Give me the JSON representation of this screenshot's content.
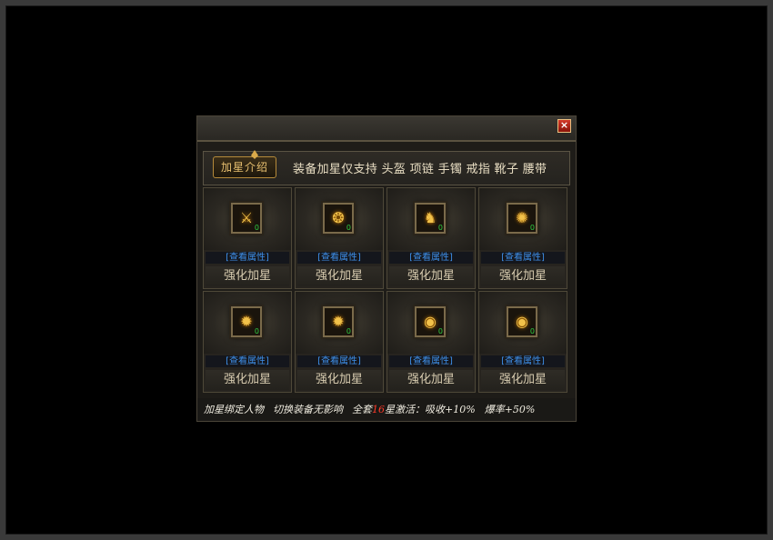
{
  "dialog": {
    "close_label": "×",
    "badge": "加星介绍",
    "support_text": "装备加星仅支持 头盔 项链 手镯 戒指 靴子 腰带"
  },
  "items": [
    {
      "icon": "sword-icon",
      "glyph": "⚔",
      "stars": "0",
      "view_label": "[查看属性]",
      "enhance_label": "强化加星"
    },
    {
      "icon": "necklace-icon",
      "glyph": "❂",
      "stars": "0",
      "view_label": "[查看属性]",
      "enhance_label": "强化加星"
    },
    {
      "icon": "boot-icon",
      "glyph": "♞",
      "stars": "0",
      "view_label": "[查看属性]",
      "enhance_label": "强化加星"
    },
    {
      "icon": "belt-icon",
      "glyph": "✺",
      "stars": "0",
      "view_label": "[查看属性]",
      "enhance_label": "强化加星"
    },
    {
      "icon": "bracelet-icon",
      "glyph": "✹",
      "stars": "0",
      "view_label": "[查看属性]",
      "enhance_label": "强化加星"
    },
    {
      "icon": "bracelet-icon",
      "glyph": "✹",
      "stars": "0",
      "view_label": "[查看属性]",
      "enhance_label": "强化加星"
    },
    {
      "icon": "ring-icon",
      "glyph": "◉",
      "stars": "0",
      "view_label": "[查看属性]",
      "enhance_label": "强化加星"
    },
    {
      "icon": "ring-icon",
      "glyph": "◉",
      "stars": "0",
      "view_label": "[查看属性]",
      "enhance_label": "强化加星"
    }
  ],
  "footer": {
    "part1": "加星绑定人物",
    "part2": "切换装备无影响",
    "part3a": "全套",
    "part3_num": "16",
    "part3b": "星激活：吸收+10%",
    "part4": "爆率+50%"
  },
  "colors": {
    "accent_gold": "#e8c070",
    "link_blue": "#3e8fe8",
    "star_green": "#2ecc40",
    "highlight_red": "#ff3b2a"
  }
}
